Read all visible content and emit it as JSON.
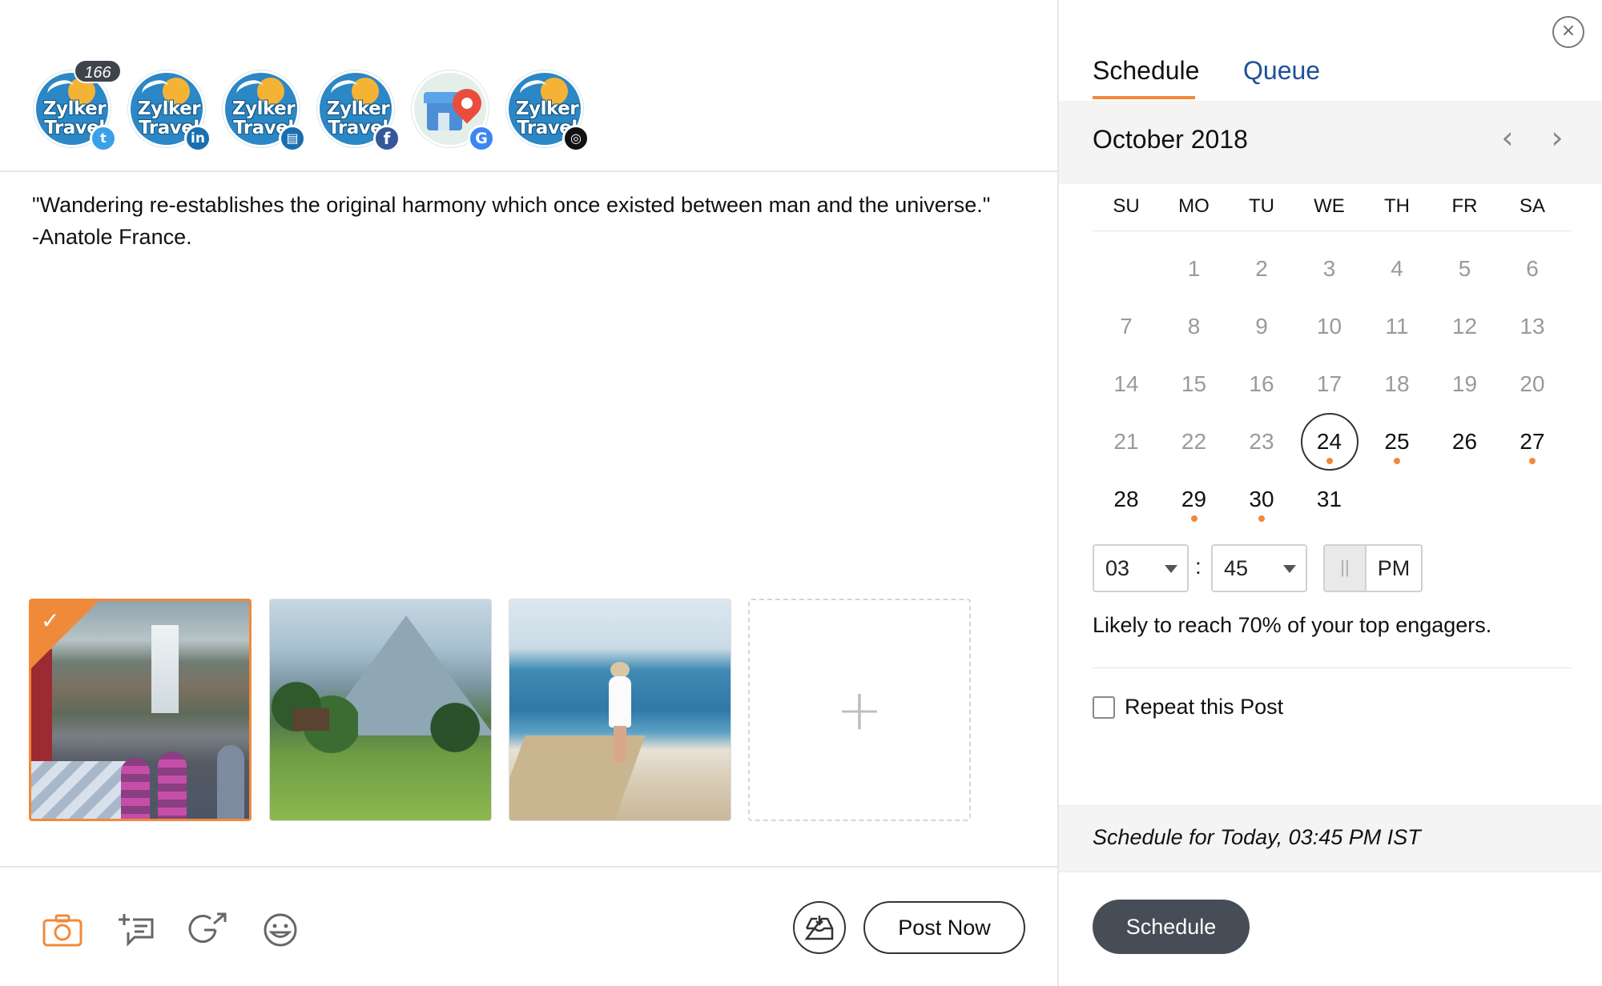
{
  "accounts": [
    {
      "name_line1": "Zylker",
      "name_line2": "Travel",
      "network": "twitter",
      "network_glyph": "t"
    },
    {
      "name_line1": "Zylker",
      "name_line2": "Travel",
      "network": "linkedin",
      "network_glyph": "in"
    },
    {
      "name_line1": "Zylker",
      "name_line2": "Travel",
      "network": "linkedin-page",
      "network_glyph": "▤"
    },
    {
      "name_line1": "Zylker",
      "name_line2": "Travel",
      "network": "facebook",
      "network_glyph": "f"
    },
    {
      "name_line1": "",
      "name_line2": "",
      "network": "google-my-business",
      "network_glyph": "G"
    },
    {
      "name_line1": "Zylker",
      "name_line2": "Travel",
      "network": "instagram",
      "network_glyph": "◎"
    }
  ],
  "character_count": "166",
  "post": {
    "line1": "\"Wandering re-establishes the original harmony which once existed between man and the universe.\"",
    "line2": "-Anatole France."
  },
  "media": {
    "images": [
      {
        "icon": "waterfall-camp-photo",
        "selected": true
      },
      {
        "icon": "alpine-valley-photo",
        "selected": false
      },
      {
        "icon": "beach-woman-photo",
        "selected": false
      }
    ],
    "add_label": "+"
  },
  "toolbar": {
    "icons": [
      "camera-icon",
      "add-text-icon",
      "google-link-icon",
      "emoji-icon",
      "inbox-icon"
    ],
    "post_now_label": "Post Now"
  },
  "schedule_panel": {
    "close_glyph": "×",
    "tabs": [
      {
        "label": "Schedule",
        "active": true
      },
      {
        "label": "Queue",
        "active": false
      }
    ],
    "month_label": "October 2018",
    "prev_glyph": "‹",
    "next_glyph": "›",
    "weekdays": [
      "SU",
      "MO",
      "TU",
      "WE",
      "TH",
      "FR",
      "SA"
    ],
    "first_weekday_index": 1,
    "days_in_month": 31,
    "today": 24,
    "days_with_posts": [
      24,
      25,
      27,
      29,
      30
    ],
    "time": {
      "hour": "03",
      "separator": ":",
      "minute": "45",
      "ampm": "PM",
      "toggle_glyph": "||"
    },
    "reach_text": "Likely to reach 70% of your top engagers.",
    "repeat_label": "Repeat this Post",
    "repeat_checked": false,
    "summary": "Schedule for Today, 03:45 PM  IST",
    "schedule_button": "Schedule"
  },
  "colors": {
    "accent": "#f08a3b",
    "queue_tab": "#1f4f9a",
    "schedule_button_bg": "#464d57"
  }
}
